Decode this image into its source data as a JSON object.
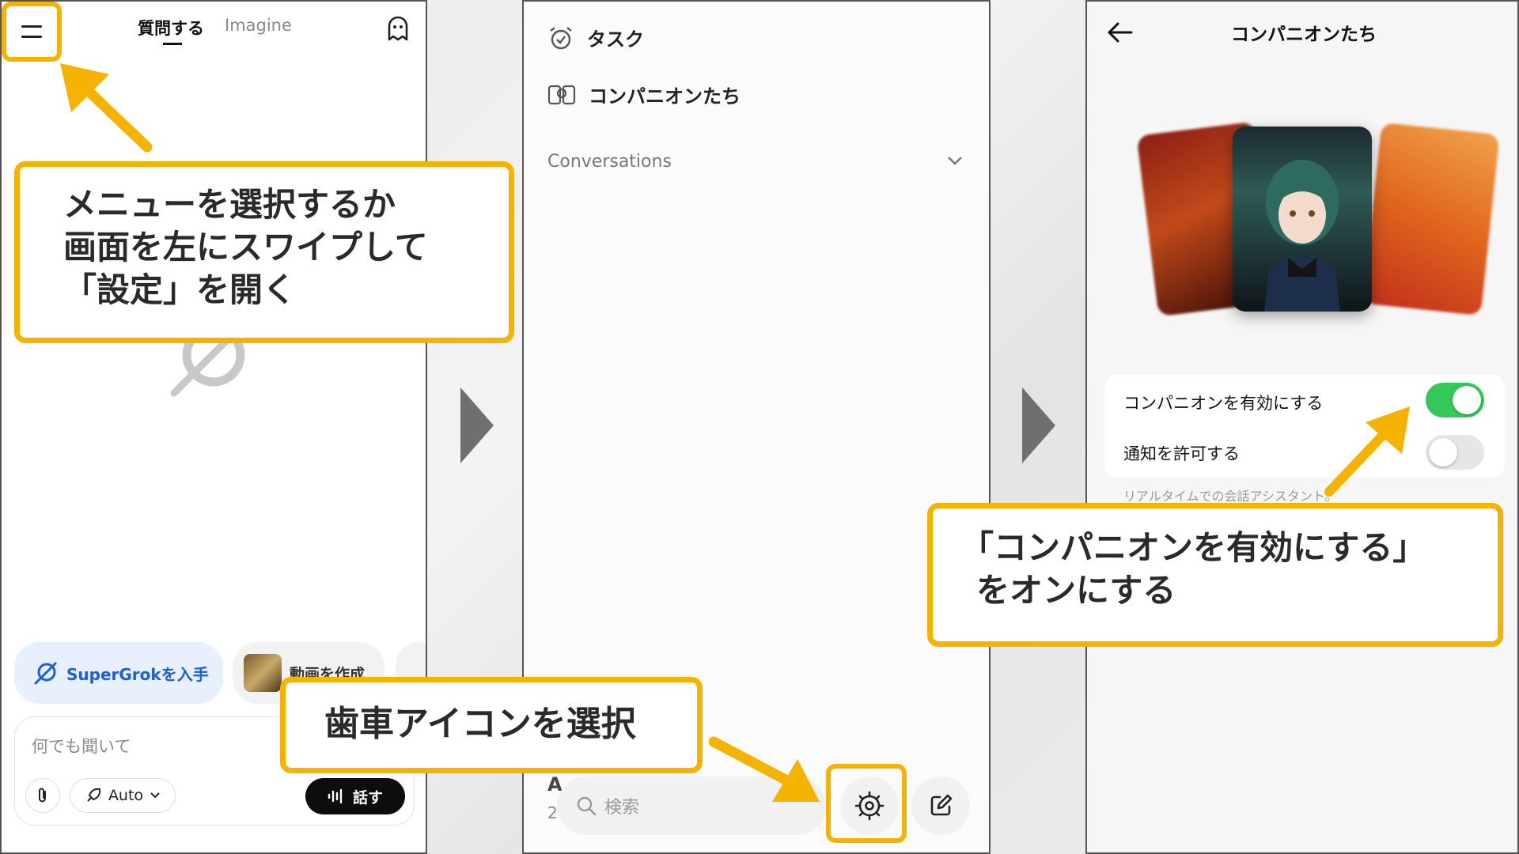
{
  "panel1": {
    "tabs": [
      "質問する",
      "Imagine"
    ],
    "callout": [
      "メニューを選択するか",
      "画面を左にスワイプして",
      "「設定」を開く"
    ],
    "chips": {
      "supergrok": "SuperGrokを入手",
      "video": "動画を作成"
    },
    "input": {
      "placeholder": "何でも聞いて",
      "mode": "Auto",
      "speak": "話す"
    }
  },
  "panel2": {
    "menu": [
      {
        "label": "タスク",
        "icon": "alarm-clock-icon"
      },
      {
        "label": "コンパニオンたち",
        "icon": "companions-icon"
      }
    ],
    "conversations_label": "Conversations",
    "callout": "歯車アイコンを選択",
    "search_placeholder": "検索",
    "partial_text": "A",
    "partial_digit": "2"
  },
  "panel3": {
    "title": "コンパニオンたち",
    "settings": [
      {
        "label": "コンパニオンを有効にする",
        "on": true
      },
      {
        "label": "通知を許可する",
        "on": false
      }
    ],
    "description": "リアルタイムでの会話アシスタント。",
    "callout": [
      "「コンパニオンを有効にする」",
      "をオンにする"
    ]
  },
  "colors": {
    "highlight": "#f5b300",
    "toggle_on": "#34c759",
    "toggle_off": "#e6e6e6",
    "link_blue": "#1d5fd6"
  }
}
